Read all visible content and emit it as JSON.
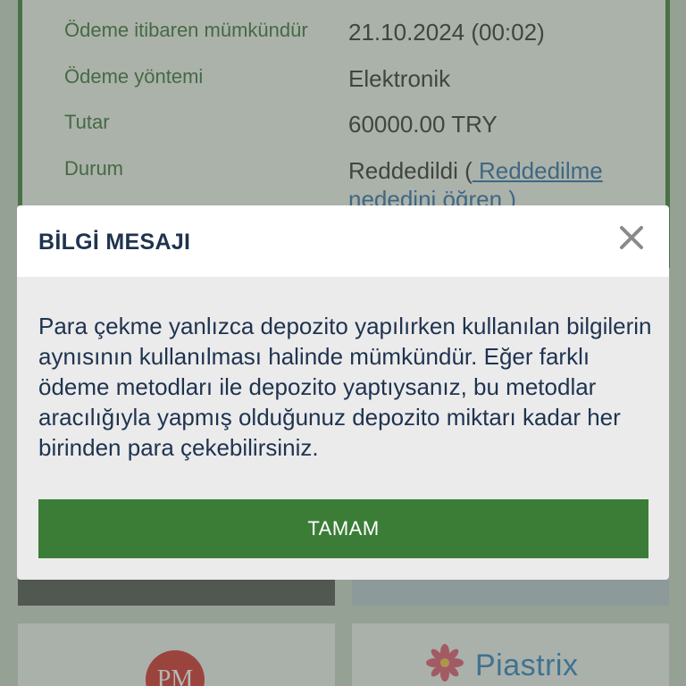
{
  "details": {
    "rows": [
      {
        "label": "Ödeme itibaren mümkündür",
        "value": "21.10.2024 (00:02)"
      },
      {
        "label": "Ödeme yöntemi",
        "value": "Elektronik"
      },
      {
        "label": "Tutar",
        "value": "60000.00 TRY"
      },
      {
        "label": "Durum",
        "value": "Reddedildi (",
        "link": " Reddedilme",
        "link_cont": "nededini öğren )"
      }
    ]
  },
  "payment_methods": {
    "pm_logo": "PM",
    "piastrix_name": "Piastrix"
  },
  "modal": {
    "title": "BİLGİ MESAJI",
    "close_icon": "close-icon",
    "message": "Para çekme yanlızca depozito yapılırken kullanılan bilgilerin aynısının kullanılması halinde mümkündür. Eğer farklı ödeme metodları ile depozito yaptıysanız, bu metodlar aracılığıyla yapmış olduğunuz depozito miktarı kadar her birinden para çekebilirsiniz.",
    "ok_label": "TAMAM"
  },
  "colors": {
    "accent_green": "#3b7d37",
    "title_navy": "#1f3350",
    "link_blue": "#2f6aa8"
  }
}
